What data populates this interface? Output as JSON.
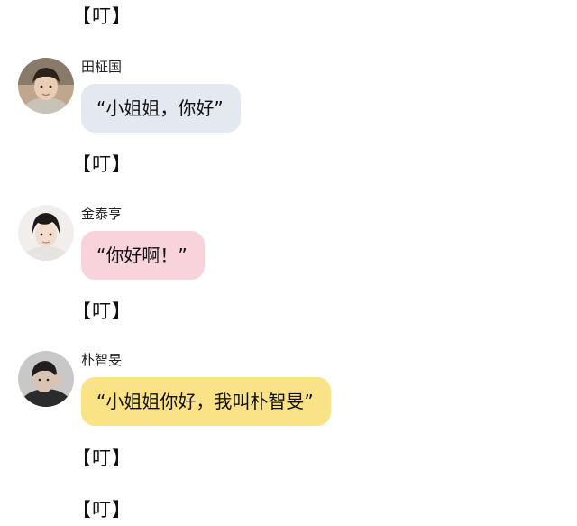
{
  "ding_text": "【叮】",
  "messages": [
    {
      "sender": "田柾国",
      "text": "“小姐姐，你好”",
      "bubble_color": "#e4e8ef",
      "avatar_icon": "avatar-jungkook"
    },
    {
      "sender": "金泰亨",
      "text": "“你好啊！”",
      "bubble_color": "#f8d3dc",
      "avatar_icon": "avatar-taehyung"
    },
    {
      "sender": "朴智旻",
      "text": "“小姐姐你好，我叫朴智旻”",
      "bubble_color": "#fae287",
      "avatar_icon": "avatar-jimin"
    }
  ]
}
